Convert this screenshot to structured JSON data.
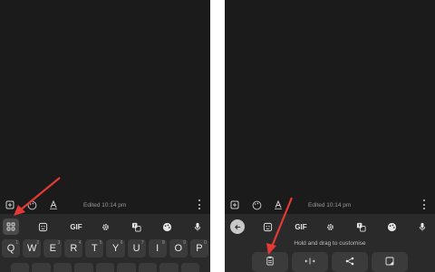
{
  "left_screen": {
    "edit_bar": {
      "edited_text": "Edited 10:14 pm"
    },
    "toolbar": {
      "gif_label": "GIF"
    },
    "keys_row1": [
      "Q",
      "W",
      "E",
      "R",
      "T",
      "Y",
      "U",
      "I",
      "O",
      "P"
    ],
    "key_hints": [
      "1",
      "2",
      "3",
      "4",
      "5",
      "6",
      "7",
      "8",
      "9",
      "0"
    ],
    "icons": [
      "plus-box-icon",
      "palette-icon",
      "text-format-icon",
      "kebab-menu-icon",
      "apps-grid-icon",
      "sticker-icon",
      "gear-icon",
      "translate-icon",
      "palette-icon",
      "microphone-icon"
    ]
  },
  "right_screen": {
    "edit_bar": {
      "edited_text": "Edited 10:14 pm"
    },
    "toolbar": {
      "gif_label": "GIF"
    },
    "hint_text": "Hold and drag to customise",
    "tiles": [
      "clipboard-icon",
      "cursor-move-icon",
      "share-icon",
      "screenshot-icon"
    ],
    "icons": [
      "back-arrow-icon",
      "sticker-icon",
      "gear-icon",
      "translate-icon",
      "palette-icon",
      "microphone-icon"
    ]
  },
  "colors": {
    "arrow": "#e53935",
    "background": "#1b1b1b",
    "keyboard": "#2a2a2a",
    "key": "#3b3b3b"
  }
}
